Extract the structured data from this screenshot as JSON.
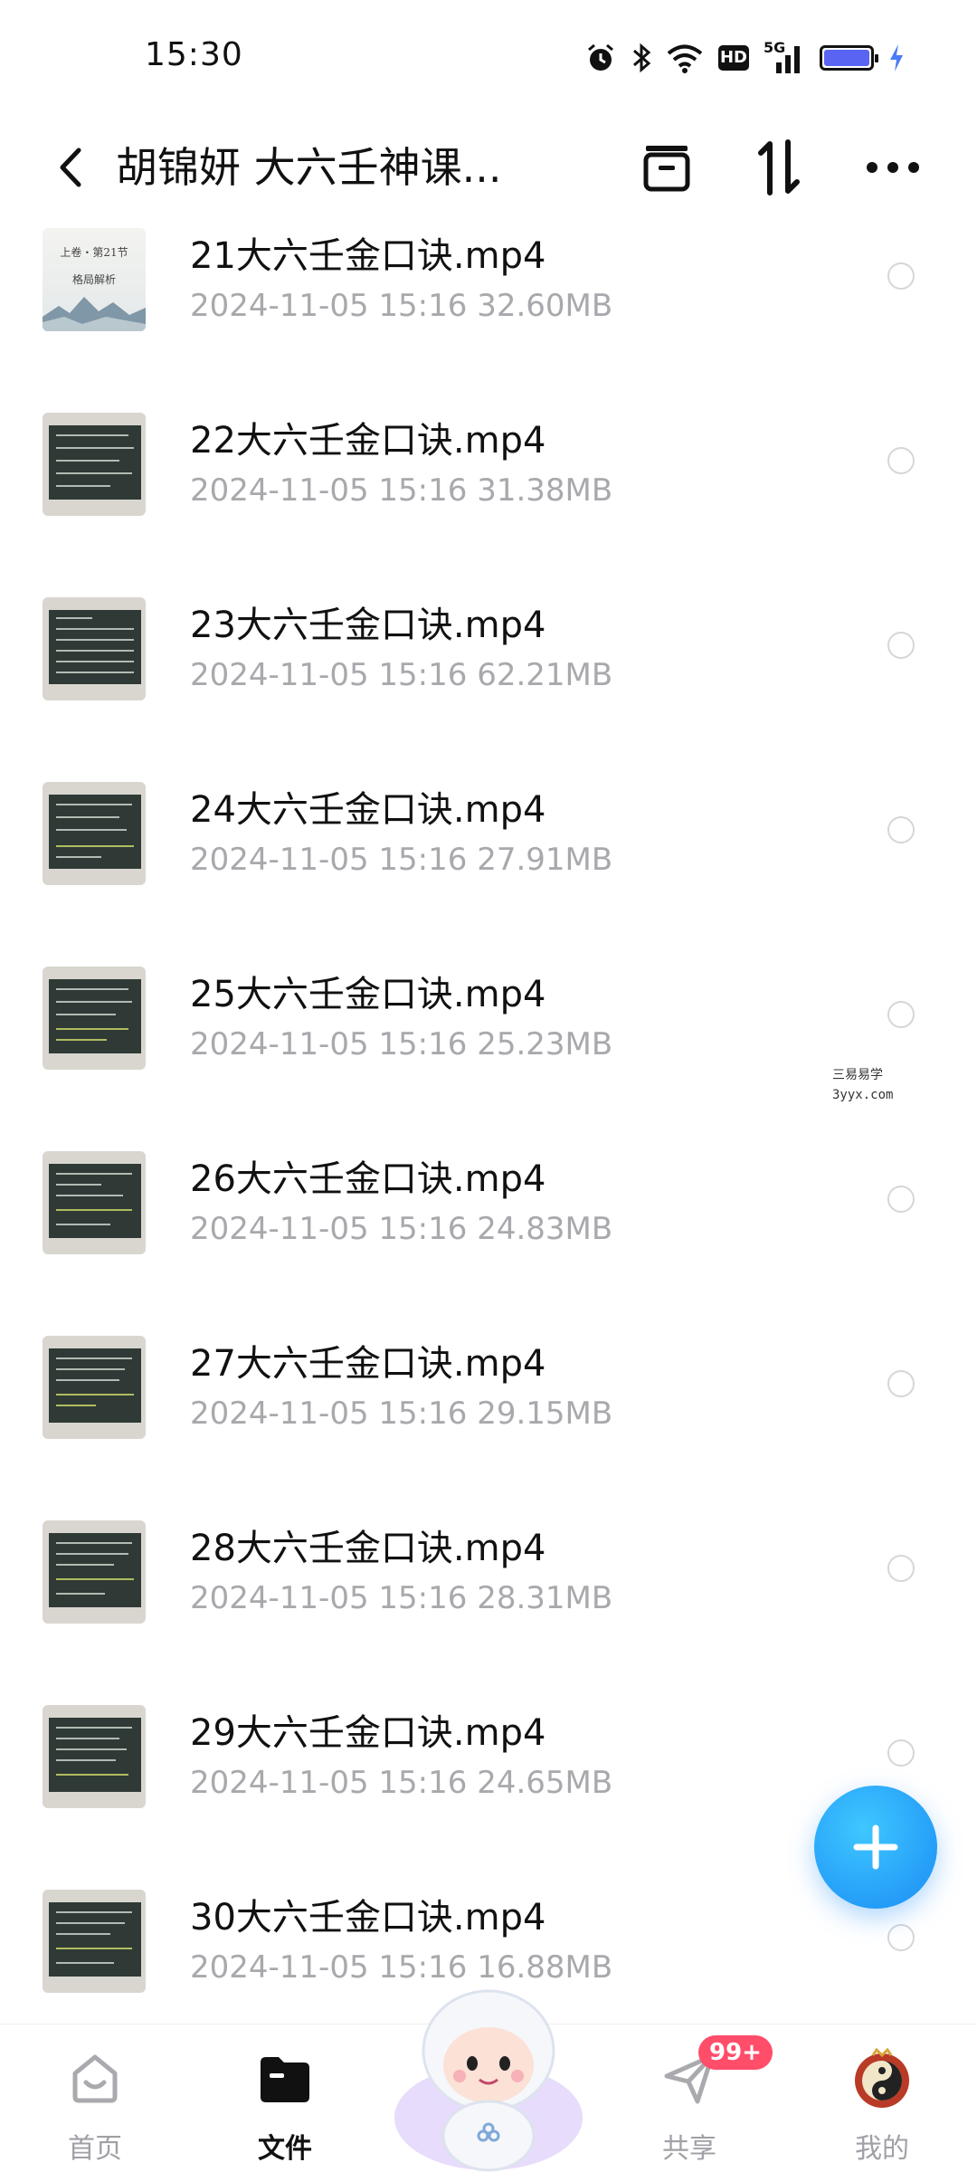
{
  "status_bar": {
    "time": "15:30",
    "icons": [
      "alarm-icon",
      "bluetooth-icon",
      "wifi-icon",
      "hd-icon",
      "5g-signal-icon",
      "battery-icon",
      "charging-icon"
    ],
    "hd_text": "HD",
    "network_text": "5G"
  },
  "header": {
    "title": "胡锦妍 大六壬神课...",
    "icons": [
      "back-icon",
      "box-icon",
      "sort-icon",
      "more-icon"
    ]
  },
  "files": [
    {
      "name": "21大六壬金口诀.mp4",
      "date": "2024-11-05  15:16",
      "size": "32.60MB",
      "thumb_title": "上卷・第21节",
      "thumb_subtitle": "格局解析"
    },
    {
      "name": "22大六壬金口诀.mp4",
      "date": "2024-11-05  15:16",
      "size": "31.38MB"
    },
    {
      "name": "23大六壬金口诀.mp4",
      "date": "2024-11-05  15:16",
      "size": "62.21MB"
    },
    {
      "name": "24大六壬金口诀.mp4",
      "date": "2024-11-05  15:16",
      "size": "27.91MB"
    },
    {
      "name": "25大六壬金口诀.mp4",
      "date": "2024-11-05  15:16",
      "size": "25.23MB"
    },
    {
      "name": "26大六壬金口诀.mp4",
      "date": "2024-11-05  15:16",
      "size": "24.83MB"
    },
    {
      "name": "27大六壬金口诀.mp4",
      "date": "2024-11-05  15:16",
      "size": "29.15MB"
    },
    {
      "name": "28大六壬金口诀.mp4",
      "date": "2024-11-05  15:16",
      "size": "28.31MB"
    },
    {
      "name": "29大六壬金口诀.mp4",
      "date": "2024-11-05  15:16",
      "size": "24.65MB"
    },
    {
      "name": "30大六壬金口诀.mp4",
      "date": "2024-11-05  15:16",
      "size": "16.88MB"
    }
  ],
  "watermark": {
    "line1": "三易易学",
    "line2": "3yyx.com"
  },
  "fab": {
    "icon": "plus-icon",
    "color": "#1a8cf5"
  },
  "bottom_nav": {
    "home": "首页",
    "files": "文件",
    "share": "共享",
    "mine": "我的",
    "share_badge": "99+",
    "active": "files"
  },
  "colors": {
    "accent": "#1a8cf5",
    "badge": "#ff4d6a",
    "meta_text": "#a8a8ad"
  }
}
